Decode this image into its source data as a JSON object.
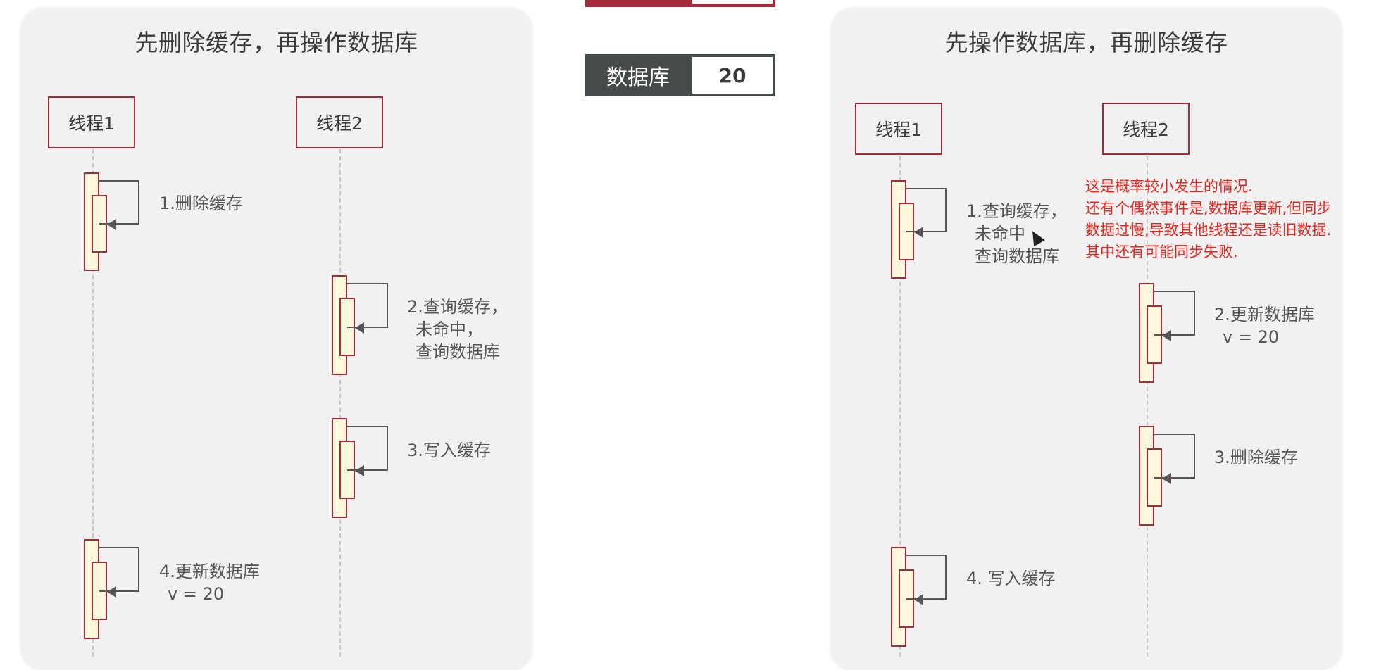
{
  "db_indicator": {
    "label": "数据库",
    "value": "20"
  },
  "left": {
    "title": "先删除缓存，再操作数据库",
    "thread1": "线程1",
    "thread2": "线程2",
    "step1": "1.删除缓存",
    "step2_line1": "2.查询缓存，",
    "step2_line2": "未命中，",
    "step2_line3": "查询数据库",
    "step3": "3.写入缓存",
    "step4_line1": "4.更新数据库",
    "step4_line2": "v = 20"
  },
  "right": {
    "title": "先操作数据库，再删除缓存",
    "thread1": "线程1",
    "thread2": "线程2",
    "step1_line1": "1.查询缓存，",
    "step1_line2": "未命中",
    "step1_line3": "查询数据库",
    "step2_line1": "2.更新数据库",
    "step2_line2": "v = 20",
    "step3": "3.删除缓存",
    "step4": "4. 写入缓存",
    "note_lines": [
      "这是概率较小发生的情况.",
      "还有个偶然事件是,数据库更新,但同步",
      "数据过慢,导致其他线程还是读旧数据.",
      "其中还有可能同步失败."
    ]
  }
}
